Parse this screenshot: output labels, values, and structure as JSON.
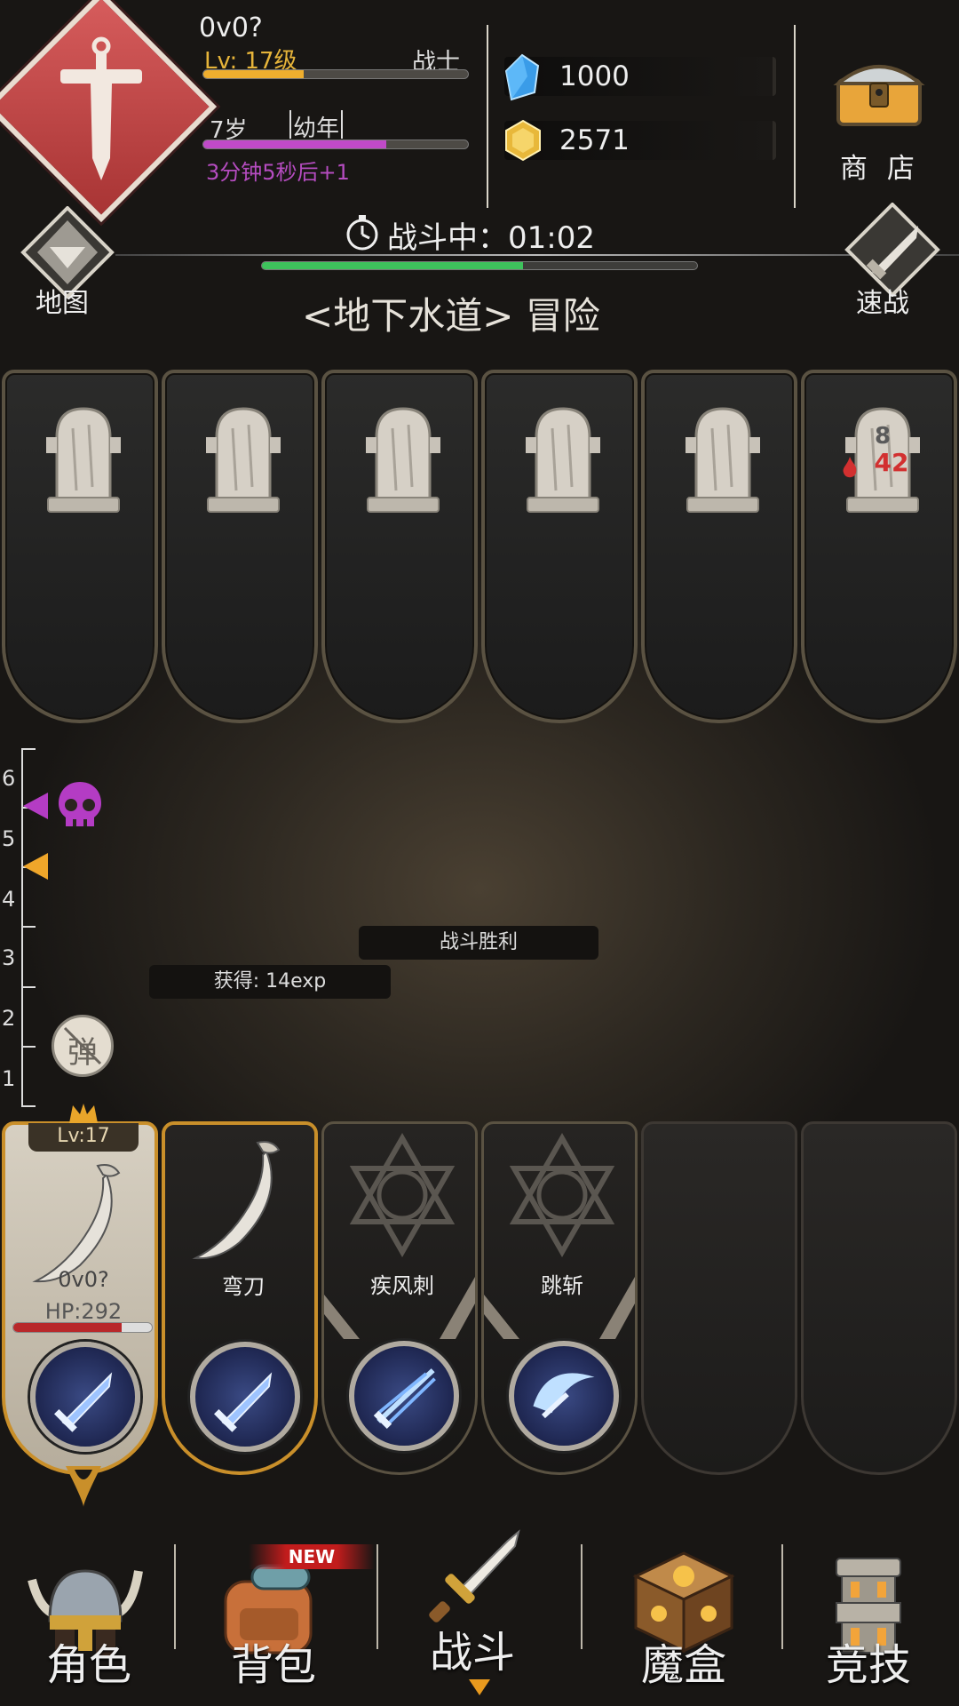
{
  "player": {
    "name": "0v0?",
    "level_text": "Lv: 17级",
    "class": "战士",
    "exp_fraction": 0.38,
    "age": "7岁",
    "age_stage": "幼年",
    "age_fraction": 0.69,
    "age_timer": "3分钟5秒后+1"
  },
  "resources": {
    "gems": "1000",
    "gold": "2571"
  },
  "shop": {
    "label": "商 店"
  },
  "battle": {
    "status": "战斗中：01:02",
    "progress_fraction": 0.6,
    "map_label": "地图",
    "quick_battle_label": "速战",
    "stage_title": "<地下水道> 冒险"
  },
  "enemies": [
    {
      "state": "tomb"
    },
    {
      "state": "tomb"
    },
    {
      "state": "tomb"
    },
    {
      "state": "tomb"
    },
    {
      "state": "tomb"
    },
    {
      "state": "tomb",
      "level_top": "8",
      "level_bottom": "42"
    }
  ],
  "ladder": {
    "ticks": [
      "6",
      "5",
      "4",
      "3",
      "2",
      "1"
    ],
    "bullet_label": "弹"
  },
  "messages": {
    "victory": "战斗胜利",
    "exp_gain": "获得: 14exp"
  },
  "cards": [
    {
      "type": "hero",
      "lvl": "Lv:17",
      "name": "0v0?",
      "hp": "HP:292",
      "hp_fraction": 0.78,
      "skill_icon": "sword-icon"
    },
    {
      "type": "weapon",
      "name": "弯刀",
      "skill_icon": "sword-icon"
    },
    {
      "type": "skill",
      "name": "疾风刺",
      "skill_icon": "triple-thrust-icon"
    },
    {
      "type": "skill",
      "name": "跳斩",
      "skill_icon": "slash-arc-icon"
    },
    {
      "type": "empty"
    },
    {
      "type": "empty"
    }
  ],
  "nav": {
    "role": "角色",
    "bag": "背包",
    "bag_badge": "NEW",
    "battle": "战斗",
    "magic_box": "魔盒",
    "arena": "竞技"
  },
  "colors": {
    "exp": "#efae2e",
    "age": "#c04ac8",
    "progress": "#3ec25c",
    "enemy_level": "#d23030",
    "emblem": "#c44646"
  }
}
